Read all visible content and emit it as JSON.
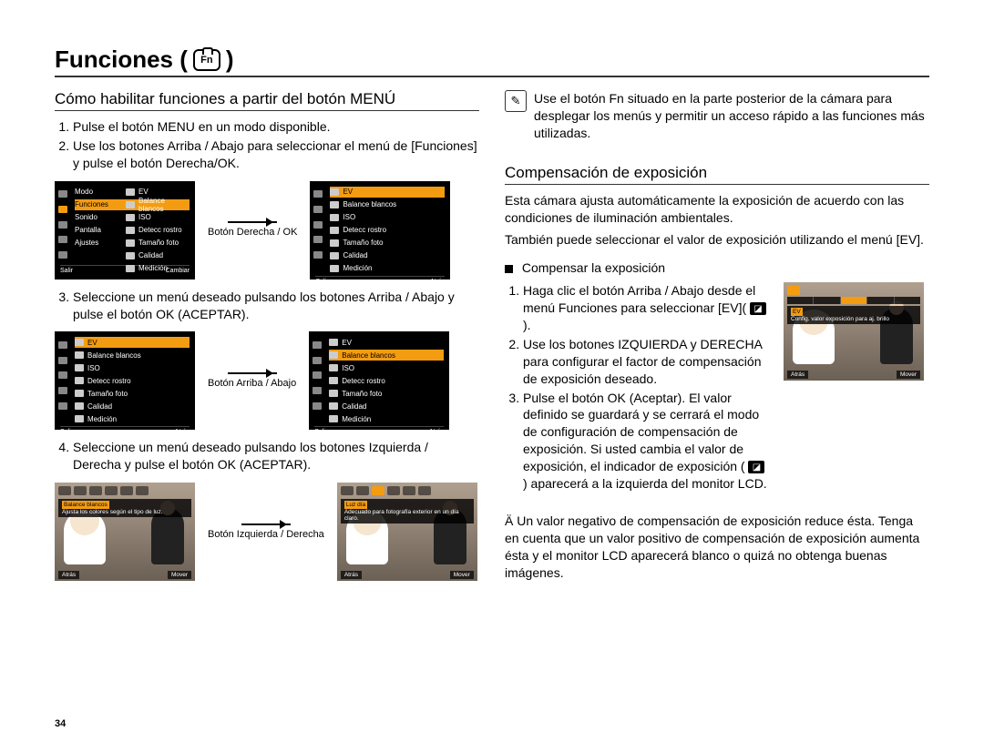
{
  "title": "Funciones (",
  "title_close": ")",
  "page_number": "34",
  "left": {
    "heading": "Cómo habilitar funciones a partir del botón MENÚ",
    "step1": "Pulse el botón MENU en un modo disponible.",
    "step2": "Use los botones Arriba / Abajo para seleccionar el menú de [Funciones] y pulse el botón Derecha/OK.",
    "btn_derecha": "Botón Derecha / OK",
    "step3": "Seleccione un menú deseado pulsando los botones Arriba / Abajo y pulse el botón OK (ACEPTAR).",
    "btn_arriba": "Botón Arriba / Abajo",
    "step4": "Seleccione un menú deseado pulsando los botones Izquierda / Derecha y pulse el botón OK (ACEPTAR).",
    "btn_izq": "Botón Izquierda / Derecha",
    "menu": {
      "modo": "Modo",
      "funciones": "Funciones",
      "sonido": "Sonido",
      "pantalla": "Pantalla",
      "ajustes": "Ajustes",
      "ev": "EV",
      "balance": "Balance blancos",
      "iso": "ISO",
      "detecc": "Detecc rostro",
      "tamano": "Tamaño foto",
      "calidad": "Calidad",
      "medicion": "Medición",
      "salir": "Salir",
      "cambiar": "Cambiar",
      "atras": "Atrás",
      "mover": "Mover",
      "luzdia": "Luz día",
      "wb_desc": "Ajusta los colores según el tipo de luz.",
      "luz_desc": "Adecuado para fotografía exterior en un día claro."
    }
  },
  "right": {
    "tip": "Use el botón Fn situado en la parte posterior de la cámara para desplegar los menús y permitir un acceso rápido a las funciones más utilizadas.",
    "heading": "Compensación de exposición",
    "p1": "Esta cámara ajusta automáticamente la exposición de acuerdo con las condiciones de iluminación ambientales.",
    "p2": "También puede seleccionar el valor de exposición utilizando el menú [EV].",
    "bullet": "Compensar la exposición",
    "s1": "Haga clic el botón Arriba / Abajo desde el menú Funciones para seleccionar [EV](",
    "s1_close": ").",
    "s2": "Use los botones IZQUIERDA y DERECHA para configurar el factor de compensación de exposición deseado.",
    "s3": "Pulse el botón OK (Aceptar). El valor definido se guardará y se cerrará el modo de configuración de compensación de exposición. Si usted cambia el valor de exposición, el indicador de exposición (",
    "s3_close": ")  aparecerá a la izquierda del monitor LCD.",
    "ev_screen": {
      "ev": "EV",
      "caption": "Config. valor exposición para aj. brillo",
      "atras": "Atrás",
      "mover": "Mover"
    },
    "note": "Ä Un valor negativo de compensación de exposición reduce ésta. Tenga en cuenta que un valor positivo de compensación de exposición aumenta ésta y el monitor LCD aparecerá blanco o quizá no obtenga buenas imágenes."
  }
}
